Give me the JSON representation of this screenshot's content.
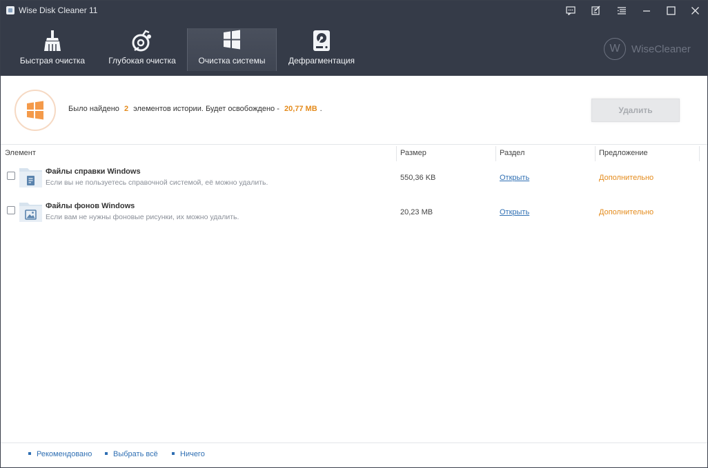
{
  "window": {
    "title": "Wise Disk Cleaner 11"
  },
  "titlebar_buttons": [
    "feedback-icon",
    "skin-icon",
    "menu-icon",
    "minimize-icon",
    "maximize-icon",
    "close-icon"
  ],
  "nav": {
    "tabs": [
      {
        "label": "Быстрая очистка",
        "icon": "broom-icon",
        "active": false
      },
      {
        "label": "Глубокая очистка",
        "icon": "deep-clean-icon",
        "active": false
      },
      {
        "label": "Очистка системы",
        "icon": "windows-icon",
        "active": true
      },
      {
        "label": "Дефрагментация",
        "icon": "disk-icon",
        "active": false
      }
    ]
  },
  "brand": {
    "letter": "W",
    "name": "WiseCleaner"
  },
  "summary": {
    "prefix": "Было найдено",
    "count": "2",
    "middle": "элементов истории. Будет освобождено -",
    "size": "20,77 MB",
    "suffix": ".",
    "delete_label": "Удалить",
    "accent_color": "#e48b1c"
  },
  "table": {
    "columns": [
      "Элемент",
      "Размер",
      "Раздел",
      "Предложение"
    ],
    "rows": [
      {
        "title": "Файлы справки Windows",
        "description": "Если вы не пользуетесь справочной системой, её можно удалить.",
        "size": "550,36 KB",
        "link": "Открыть",
        "suggestion": "Дополнительно",
        "icon": "help-file-folder-icon"
      },
      {
        "title": "Файлы фонов Windows",
        "description": "Если вам не нужны фоновые рисунки, их можно удалить.",
        "size": "20,23 MB",
        "link": "Открыть",
        "suggestion": "Дополнительно",
        "icon": "image-folder-icon"
      }
    ]
  },
  "footer": {
    "recommended": "Рекомендовано",
    "select_all": "Выбрать всё",
    "none": "Ничего"
  }
}
